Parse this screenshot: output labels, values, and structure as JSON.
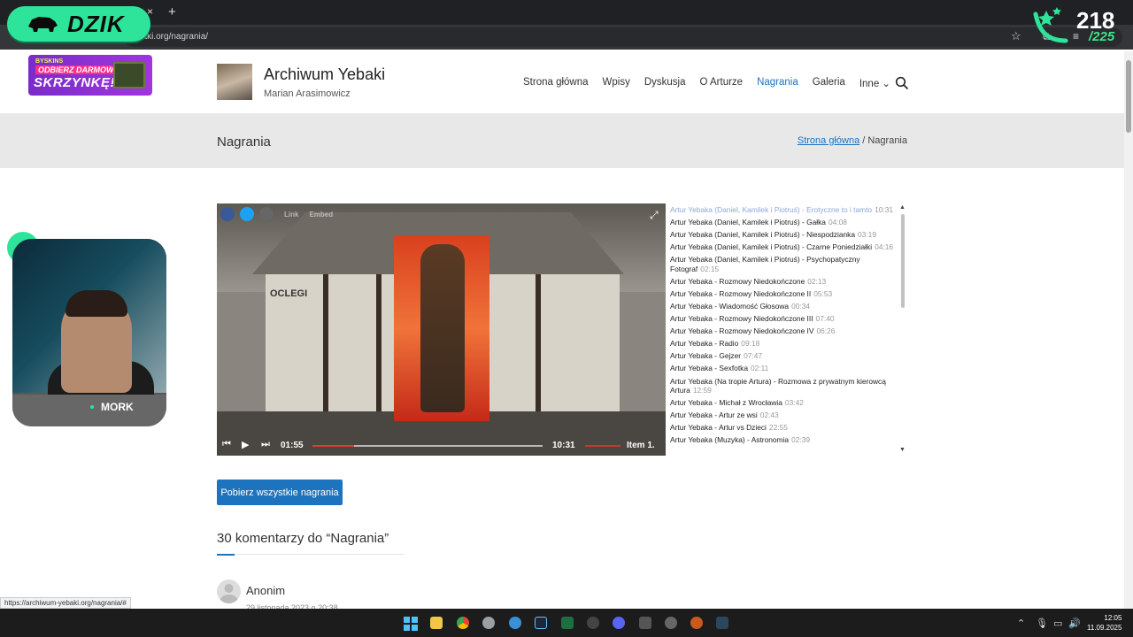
{
  "browser": {
    "url": "akaki.org/nagrania/",
    "new_tab": "+",
    "close_tab": "×"
  },
  "overlay": {
    "brand": "DZIK",
    "counter_current": "218",
    "counter_total": "/225",
    "webcam_name": "MORK"
  },
  "promo": {
    "small": "BYSKINS",
    "line1": "ODBIERZ DARMOWĄ",
    "line2": "SKRZYNKĘ!"
  },
  "site": {
    "title": "Archiwum Yebaki",
    "subtitle": "Marian Arasimowicz"
  },
  "nav": {
    "items": [
      "Strona główna",
      "Wpisy",
      "Dyskusja",
      "O Arturze",
      "Nagrania",
      "Galeria",
      "Inne"
    ],
    "active": "Nagrania"
  },
  "page": {
    "title": "Nagrania",
    "breadcrumb_home": "Strona główna",
    "breadcrumb_sep": " / ",
    "breadcrumb_current": "Nagrania"
  },
  "player": {
    "share_link": "Link",
    "share_embed": "Embed",
    "sign_text": "OCLEGI",
    "current_time": "01:55",
    "total_time": "10:31",
    "item_label": "Item 1.",
    "progress_percent": 18
  },
  "playlist": [
    {
      "title": "Artur Yebaka (Daniel, Kamilek i Piotruś) - Erotyczne to i tamto",
      "duration": "10:31",
      "active": true
    },
    {
      "title": "Artur Yebaka (Daniel, Kamilek i Piotruś) - Gałka",
      "duration": "04:08"
    },
    {
      "title": "Artur Yebaka (Daniel, Kamilek i Piotruś) - Niespodzianka",
      "duration": "03:19"
    },
    {
      "title": "Artur Yebaka (Daniel, Kamilek i Piotruś) - Czarne Poniedziałki",
      "duration": "04:16"
    },
    {
      "title": "Artur Yebaka (Daniel, Kamilek i Piotruś) - Psychopatyczny Fotograf",
      "duration": "02:15"
    },
    {
      "title": "Artur Yebaka - Rozmowy Niedokończone",
      "duration": "02:13"
    },
    {
      "title": "Artur Yebaka - Rozmowy Niedokończone II",
      "duration": "05:53"
    },
    {
      "title": "Artur Yebaka - Wiadomość Głosowa",
      "duration": "00:34"
    },
    {
      "title": "Artur Yebaka - Rozmowy Niedokończone III",
      "duration": "07:40"
    },
    {
      "title": "Artur Yebaka - Rozmowy Niedokończone IV",
      "duration": "06:26"
    },
    {
      "title": "Artur Yebaka - Radio",
      "duration": "09:18"
    },
    {
      "title": "Artur Yebaka - Gejzer",
      "duration": "07:47"
    },
    {
      "title": "Artur Yebaka - Sexfotka",
      "duration": "02:11"
    },
    {
      "title": "Artur Yebaka (Na tropie Artura) - Rozmowa z prywatnym kierowcą Artura",
      "duration": "12:59"
    },
    {
      "title": "Artur Yebaka - Michał z Wrocławia",
      "duration": "03:42"
    },
    {
      "title": "Artur Yebaka - Artur ze wsi",
      "duration": "02:43"
    },
    {
      "title": "Artur Yebaka - Artur vs Dzieci",
      "duration": "22:55"
    },
    {
      "title": "Artur Yebaka (Muzyka) - Astronomia",
      "duration": "02:39"
    }
  ],
  "download_button": "Pobierz wszystkie nagrania",
  "comments": {
    "heading": "30 komentarzy do “Nagrania”",
    "first_author": "Anonim",
    "first_date": "29 listopada 2023 o 20:38"
  },
  "status_url": "https://archiwum-yebaki.org/nagrania/#",
  "taskbar": {
    "time": "12:05",
    "date": "11.09.2025"
  },
  "colors": {
    "accent": "#1e73be",
    "brand_green": "#2ee39a",
    "progress": "#e23a3a"
  }
}
